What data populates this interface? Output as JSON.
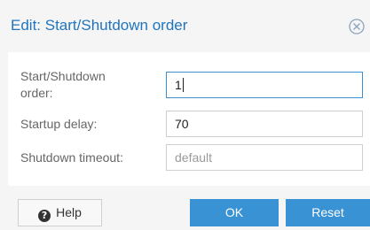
{
  "dialog": {
    "title": "Edit: Start/Shutdown order"
  },
  "form": {
    "order": {
      "label_line1": "Start/Shutdown",
      "label_line2": "order:",
      "value": "1"
    },
    "startup_delay": {
      "label": "Startup delay:",
      "value": "70"
    },
    "shutdown_timeout": {
      "label": "Shutdown timeout:",
      "placeholder": "default"
    }
  },
  "footer": {
    "help_label": "Help",
    "help_icon": "question-circle-icon",
    "ok_label": "OK",
    "reset_label": "Reset"
  },
  "colors": {
    "accent": "#3892d3",
    "title": "#1f75bd"
  }
}
